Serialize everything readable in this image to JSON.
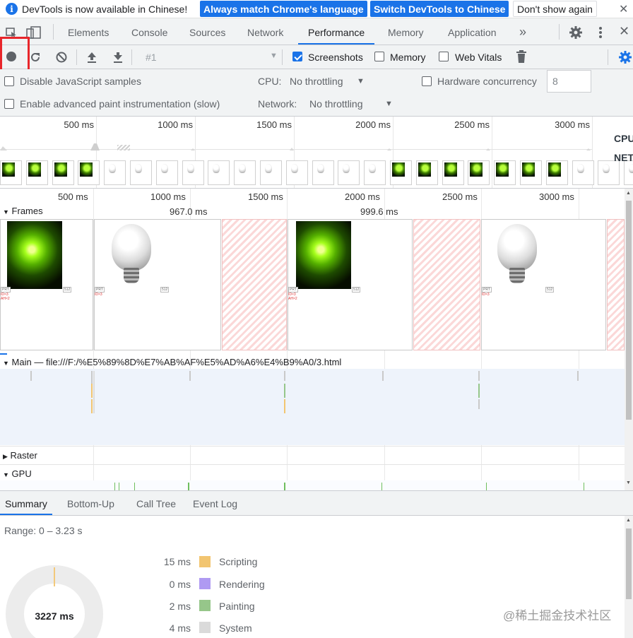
{
  "infobar": {
    "message": "DevTools is now available in Chinese!",
    "btn_match": "Always match Chrome's language",
    "btn_switch": "Switch DevTools to Chinese",
    "btn_dismiss": "Don't show again"
  },
  "tabs": [
    "Elements",
    "Console",
    "Sources",
    "Network",
    "Performance",
    "Memory",
    "Application"
  ],
  "active_tab": "Performance",
  "more_tabs": "»",
  "toolbar": {
    "recording_select": "#1",
    "screenshots": "Screenshots",
    "memory": "Memory",
    "web_vitals": "Web Vitals",
    "screenshots_checked": true,
    "memory_checked": false,
    "web_vitals_checked": false
  },
  "settings": {
    "disable_js": "Disable JavaScript samples",
    "cpu_label": "CPU:",
    "cpu_value": "No throttling",
    "hw_label": "Hardware concurrency",
    "hw_value": "8",
    "paint": "Enable advanced paint instrumentation (slow)",
    "network_label": "Network:",
    "network_value": "No throttling"
  },
  "overview": {
    "ticks": [
      "500 ms",
      "1000 ms",
      "1500 ms",
      "2000 ms",
      "2500 ms",
      "3000 ms"
    ],
    "cpu_label": "CPU",
    "net_label": "NET"
  },
  "timeline": {
    "ticks": [
      "500 ms",
      "1000 ms",
      "1500 ms",
      "2000 ms",
      "2500 ms",
      "3000 ms"
    ],
    "frames_label": "Frames",
    "frame_durations": [
      "967.0 ms",
      "999.6 ms"
    ],
    "main_label": "Main — file:///F:/%E5%89%8D%E7%AB%AF%E5%AD%A6%E4%B9%A0/3.html",
    "raster_label": "Raster",
    "gpu_label": "GPU"
  },
  "bottom_tabs": [
    "Summary",
    "Bottom-Up",
    "Call Tree",
    "Event Log"
  ],
  "summary": {
    "range": "Range: 0 – 3.23 s",
    "total": "3227 ms",
    "legend": [
      {
        "value": "15 ms",
        "name": "Scripting",
        "color": "#f2c570"
      },
      {
        "value": "0 ms",
        "name": "Rendering",
        "color": "#af9af2"
      },
      {
        "value": "2 ms",
        "name": "Painting",
        "color": "#96c68a"
      },
      {
        "value": "4 ms",
        "name": "System",
        "color": "#dadada"
      }
    ]
  },
  "watermark": "@稀土掘金技术社区",
  "colors": {
    "accent": "#1a73e8",
    "highlight_box": "#e8262b"
  }
}
